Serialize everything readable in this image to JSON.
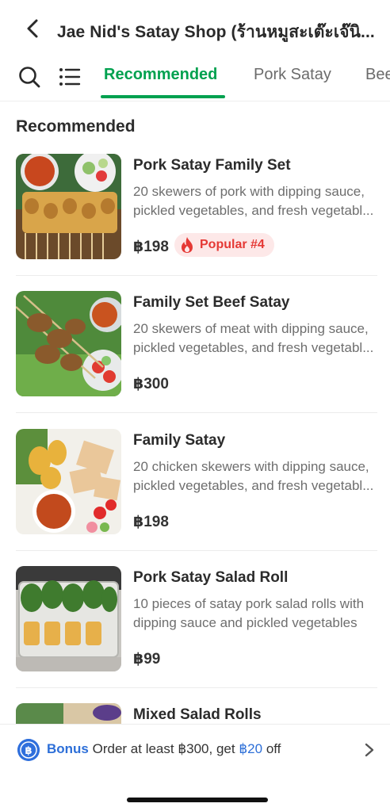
{
  "header": {
    "shop_title": "Jae Nid's Satay Shop (ร้านหมูสะเต๊ะเจ๊นิ..."
  },
  "tabs": [
    {
      "label": "Recommended",
      "active": true
    },
    {
      "label": "Pork Satay",
      "active": false
    },
    {
      "label": "Bee",
      "active": false
    }
  ],
  "section": {
    "title": "Recommended"
  },
  "items": [
    {
      "name": "Pork Satay Family Set",
      "description": "20 skewers of pork with dipping sauce, pickled vegetables, and fresh vegetabl...",
      "price": "฿198",
      "badge": "Popular #4"
    },
    {
      "name": "Family Set Beef Satay",
      "description": "20 skewers of meat with dipping sauce, pickled vegetables, and fresh vegetabl...",
      "price": "฿300"
    },
    {
      "name": "Family Satay",
      "description": "20 chicken skewers with dipping sauce, pickled vegetables, and fresh vegetabl...",
      "price": "฿198"
    },
    {
      "name": "Pork Satay Salad Roll",
      "description": "10 pieces of satay pork salad rolls with dipping sauce and pickled vegetables",
      "price": "฿99"
    },
    {
      "name": "Mixed Salad Rolls"
    }
  ],
  "bonus": {
    "label": "Bonus",
    "text_before": "Order at least ฿300, get",
    "amount": "฿20",
    "text_after": "off"
  },
  "colors": {
    "accent_green": "#00a14f",
    "bonus_blue": "#2d6fd8",
    "popular_red": "#e53935"
  }
}
